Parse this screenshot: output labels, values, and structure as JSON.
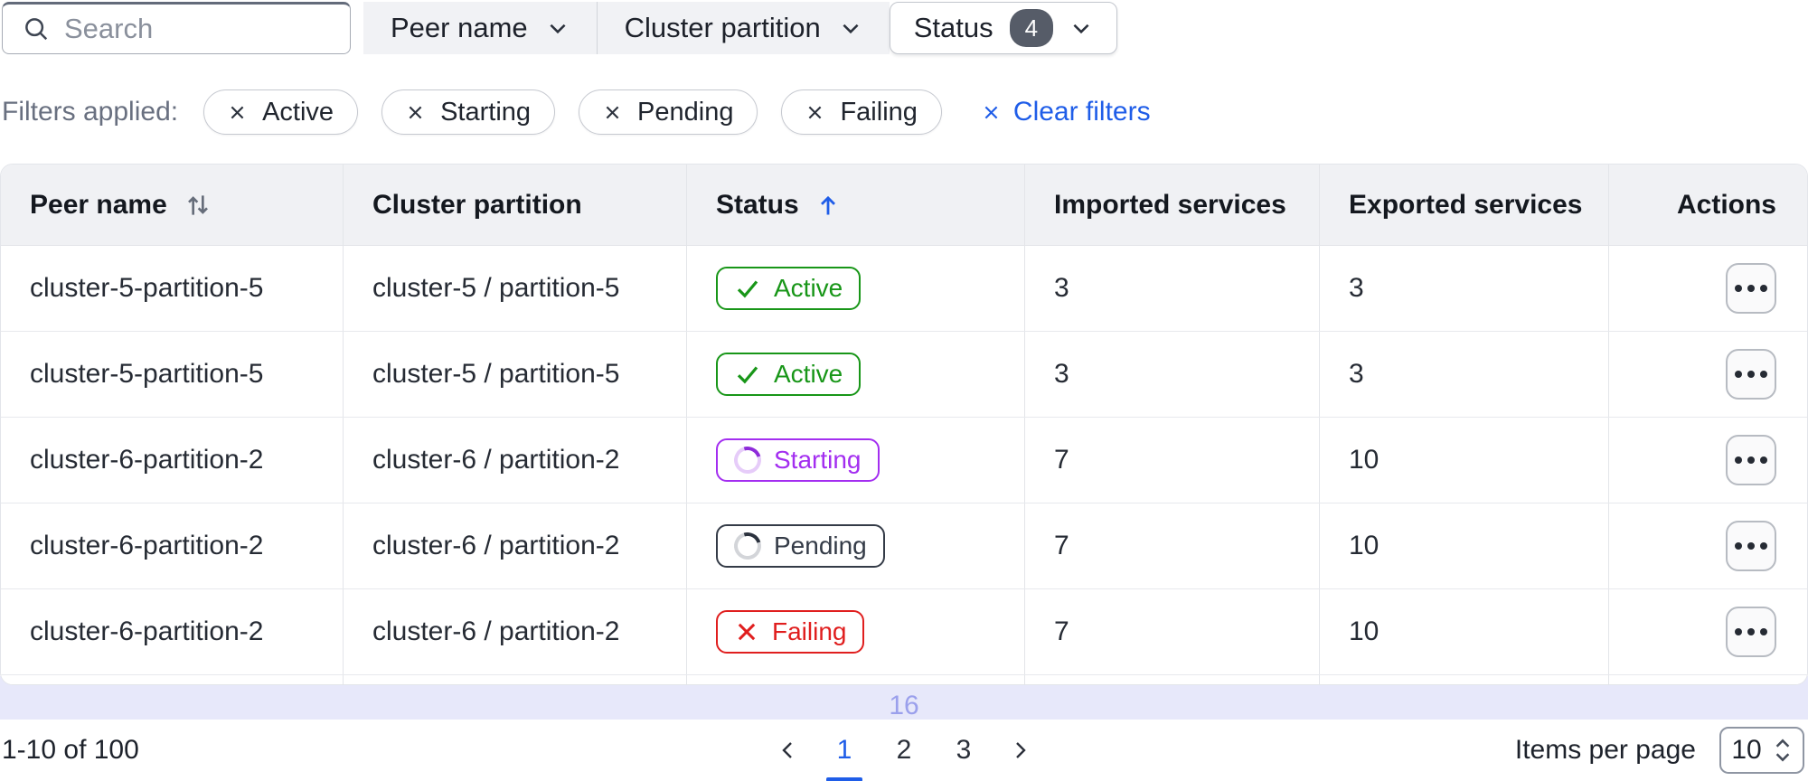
{
  "toolbar": {
    "search_placeholder": "Search",
    "peer_name_label": "Peer name",
    "cluster_partition_label": "Cluster partition",
    "status_label": "Status",
    "status_count": "4"
  },
  "applied_filters": {
    "label": "Filters applied:",
    "chips": [
      {
        "label": "Active"
      },
      {
        "label": "Starting"
      },
      {
        "label": "Pending"
      },
      {
        "label": "Failing"
      }
    ],
    "clear_label": "Clear filters"
  },
  "table": {
    "columns": {
      "peer_name": "Peer name",
      "cluster_partition": "Cluster partition",
      "status": "Status",
      "imported": "Imported services",
      "exported": "Exported services",
      "actions": "Actions"
    },
    "sort_state": {
      "peer_name": "sortable",
      "status": "ascending"
    },
    "rows": [
      {
        "peer_name": "cluster-5-partition-5",
        "cluster_partition": "cluster-5 / partition-5",
        "status": "Active",
        "imported": "3",
        "exported": "3"
      },
      {
        "peer_name": "cluster-5-partition-5",
        "cluster_partition": "cluster-5 / partition-5",
        "status": "Active",
        "imported": "3",
        "exported": "3"
      },
      {
        "peer_name": "cluster-6-partition-2",
        "cluster_partition": "cluster-6 / partition-2",
        "status": "Starting",
        "imported": "7",
        "exported": "10"
      },
      {
        "peer_name": "cluster-6-partition-2",
        "cluster_partition": "cluster-6 / partition-2",
        "status": "Pending",
        "imported": "7",
        "exported": "10"
      },
      {
        "peer_name": "cluster-6-partition-2",
        "cluster_partition": "cluster-6 / partition-2",
        "status": "Failing",
        "imported": "7",
        "exported": "10"
      }
    ]
  },
  "scroll_indicator": {
    "value": "16"
  },
  "pagination": {
    "range_label": "1-10 of 100",
    "pages": [
      {
        "label": "1"
      },
      {
        "label": "2"
      },
      {
        "label": "3"
      }
    ],
    "current_page": "1",
    "items_per_page_label": "Items per page",
    "items_per_page_value": "10"
  },
  "colors": {
    "accent_blue": "#1f5de8",
    "status_active_green": "#189618",
    "status_starting_purple": "#a32ef0",
    "status_pending_dark": "#343b47",
    "status_failing_red": "#e01e1e",
    "count_badge_bg": "#565c68",
    "scroll_bar_bg": "#e7e8fa",
    "scroll_bar_text": "#9ba0ec",
    "header_bg": "#f0f1f4"
  }
}
